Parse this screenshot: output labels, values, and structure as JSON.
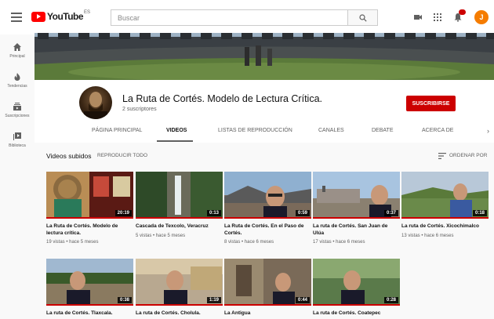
{
  "header": {
    "logo_text": "YouTube",
    "logo_country": "ES",
    "search_placeholder": "Buscar",
    "avatar_letter": "J"
  },
  "sidebar": {
    "items": [
      {
        "label": "Principal",
        "icon": "home-icon"
      },
      {
        "label": "Tendencias",
        "icon": "fire-icon"
      },
      {
        "label": "Suscripciones",
        "icon": "subscriptions-icon"
      },
      {
        "label": "Biblioteca",
        "icon": "library-icon"
      }
    ]
  },
  "channel": {
    "name": "La Ruta de Cortés. Modelo de Lectura Crítica.",
    "subscribers": "2 suscriptores",
    "subscribe_label": "SUSCRIBIRSE"
  },
  "tabs": [
    "PÁGINA PRINCIPAL",
    "VIDEOS",
    "LISTAS DE REPRODUCCIÓN",
    "CANALES",
    "DEBATE",
    "ACERCA DE"
  ],
  "active_tab": "VIDEOS",
  "section": {
    "title": "Videos subidos",
    "play_all": "REPRODUCIR TODO",
    "sort_label": "ORDENAR POR"
  },
  "videos": [
    {
      "title": "La Ruta de Cortés. Modelo de lectura crítica.",
      "meta": "19 vistas • hace 5 meses",
      "duration": "20:19",
      "watched": 1.0
    },
    {
      "title": "Cascada de Texcolo, Veracruz",
      "meta": "5 vistas • hace 5 meses",
      "duration": "0:13",
      "watched": 1.0
    },
    {
      "title": "La Ruta de Cortés. En el Paso de Cortés.",
      "meta": "8 vistas • hace 6 meses",
      "duration": "0:59",
      "watched": 1.0
    },
    {
      "title": "La ruta de Cortés. San Juan de Ulúa",
      "meta": "17 vistas • hace 6 meses",
      "duration": "0:37",
      "watched": 1.0
    },
    {
      "title": "La ruta de Cortés. Xicochimalco",
      "meta": "13 vistas • hace 6 meses",
      "duration": "0:18",
      "watched": 1.0
    },
    {
      "title": "La ruta de Cortés. Tlaxcala.",
      "meta": "",
      "duration": "0:38",
      "watched": 1.0
    },
    {
      "title": "La ruta de Cortés. Cholula.",
      "meta": "",
      "duration": "1:19",
      "watched": 1.0
    },
    {
      "title": "La Antigua",
      "meta": "",
      "duration": "0:44",
      "watched": 1.0
    },
    {
      "title": "La ruta de Cortés. Coatepec",
      "meta": "",
      "duration": "0:28",
      "watched": 1.0
    }
  ],
  "colors": {
    "brand_red": "#cc0000",
    "avatar_orange": "#f57c00"
  }
}
